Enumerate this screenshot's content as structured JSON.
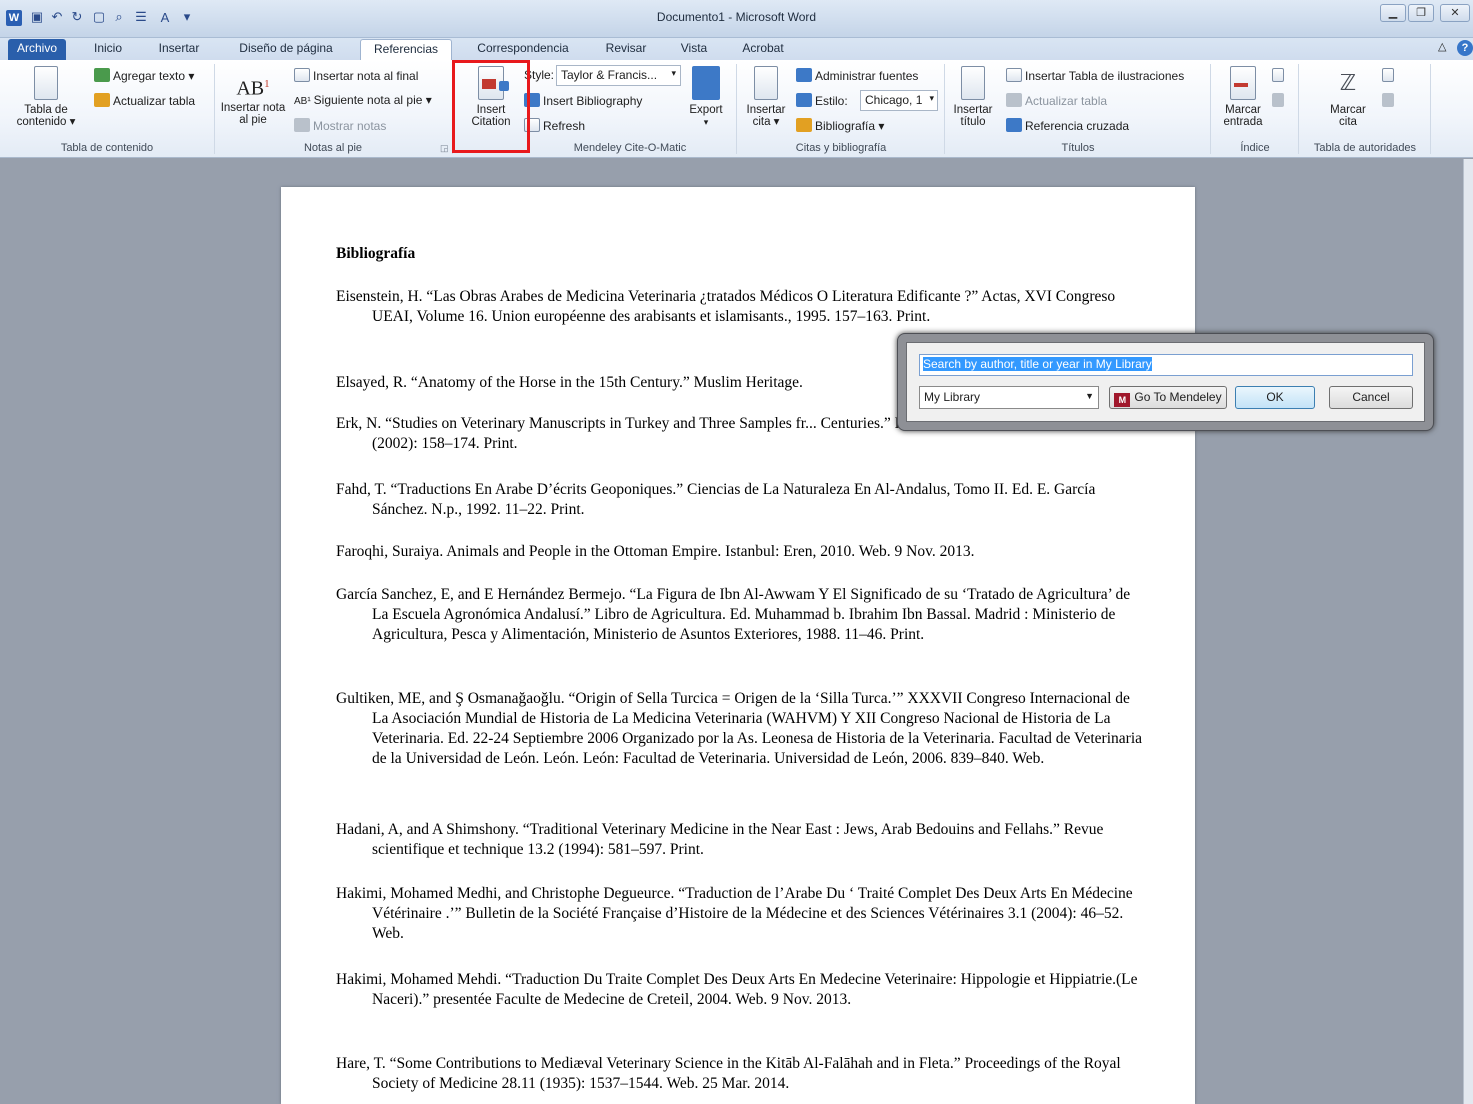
{
  "window": {
    "title": "Documento1 - Microsoft Word",
    "controls": [
      "▁",
      "❐",
      "✕"
    ]
  },
  "tabs": [
    {
      "label": "Archivo"
    },
    {
      "label": "Inicio"
    },
    {
      "label": "Insertar"
    },
    {
      "label": "Diseño de página"
    },
    {
      "label": "Referencias"
    },
    {
      "label": "Correspondencia"
    },
    {
      "label": "Revisar"
    },
    {
      "label": "Vista"
    },
    {
      "label": "Acrobat"
    }
  ],
  "active_tab": "Referencias",
  "ribbon": {
    "toc": {
      "table_btn": "Tabla de contenido ▾",
      "add_text": "Agregar texto ▾",
      "update_table": "Actualizar tabla",
      "group": "Tabla de contenido"
    },
    "footnotes": {
      "insert_footnote": "Insertar nota al pie",
      "insert_endnote": "Insertar nota al final",
      "next_footnote": "Siguiente nota al pie ▾",
      "show_notes": "Mostrar notas",
      "group": "Notas al pie"
    },
    "mendeley": {
      "insert_citation": "Insert Citation",
      "style_label": "Style:",
      "style_value": "Taylor & Francis...",
      "insert_bibliography": "Insert Bibliography",
      "refresh": "Refresh",
      "export": "Export",
      "group": "Mendeley Cite-O-Matic"
    },
    "citations": {
      "insert_cite": "Insertar cita ▾",
      "manage_sources": "Administrar fuentes",
      "style_label": "Estilo:",
      "style_value": "Chicago, 1",
      "bibliography": "Bibliografía ▾",
      "group": "Citas y bibliografía"
    },
    "captions": {
      "insert_caption": "Insertar título",
      "insert_table_figures": "Insertar Tabla de ilustraciones",
      "update_table": "Actualizar tabla",
      "cross_reference": "Referencia cruzada",
      "group": "Títulos"
    },
    "index": {
      "mark_entry": "Marcar entrada",
      "group": "Índice"
    },
    "authorities": {
      "mark_citation": "Marcar cita",
      "group": "Tabla de autoridades"
    }
  },
  "document": {
    "heading": "Bibliografía",
    "entries": [
      "Eisenstein, H. “Las Obras Arabes de Medicina Veterinaria ¿tratados Médicos O Literatura Edificante ?” Actas, XVI Congreso UEAI, Volume 16. Union européenne des arabisants et islamisants., 1995. 157–163. Print.",
      "Elsayed, R. “Anatomy of the Horse in the 15th Century.” Muslim Heritage.",
      "Erk, N. “Studies on Veterinary Manuscripts in Turkey and Three Samples fr... Centuries.” Historia medicinae veterinariae 27.1 (2002): 158–174. Print.",
      "Fahd, T. “Traductions En Arabe D’écrits Geoponiques.” Ciencias de La Naturaleza En Al-Andalus, Tomo II. Ed. E. García Sánchez. N.p., 1992. 11–22. Print.",
      "Faroqhi, Suraiya. Animals and People in the Ottoman Empire. Istanbul: Eren, 2010. Web. 9 Nov. 2013.",
      "García Sanchez, E, and E Hernández Bermejo. “La Figura de Ibn Al-Awwam Y El Significado de su ‘Tratado de Agricultura’ de La Escuela Agronómica Andalusí.” Libro de Agricultura. Ed. Muhammad b. Ibrahim Ibn Bassal. Madrid : Ministerio de Agricultura, Pesca y Alimentación, Ministerio de Asuntos Exteriores, 1988. 11–46. Print.",
      "Gultiken, ME, and Ş Osmanağaoğlu. “Origin of Sella Turcica = Origen de la ‘Silla Turca.’” XXXVII Congreso Internacional de La Asociación Mundial de Historia de La Medicina Veterinaria (WAHVM) Y XII Congreso Nacional de Historia de La Veterinaria. Ed. 22-24 Septiembre 2006 Organizado por la As. Leonesa de Historia de la Veterinaria. Facultad de Veterinaria de la Universidad de León. León. León: Facultad de Veterinaria. Universidad de León, 2006. 839–840. Web.",
      "Hadani, A, and A Shimshony. “Traditional Veterinary Medicine in the Near East : Jews, Arab Bedouins and Fellahs.” Revue scientifique et technique 13.2 (1994): 581–597. Print.",
      "Hakimi, Mohamed Medhi, and Christophe Degueurce. “Traduction de l’Arabe Du ‘ Traité Complet Des Deux Arts En Médecine Vétérinaire .’” Bulletin de la Société Française d’Histoire de la Médecine et des Sciences Vétérinaires 3.1 (2004): 46–52. Web.",
      "Hakimi, Mohamed Mehdi. “Traduction Du Traite Complet Des Deux Arts En Medecine Veterinaire: Hippologie et Hippiatrie.(Le Naceri).” presentée Faculte de Medecine de Creteil, 2004. Web. 9 Nov. 2013.",
      "Hare, T. “Some Contributions to Mediæval Veterinary Science in the Kitāb Al-Falāhah and in Fleta.” Proceedings of the Royal Society of Medicine 28.11 (1935): 1537–1544. Web. 25 Mar. 2014."
    ]
  },
  "dialog": {
    "search_placeholder": "Search by author, title or year in My Library",
    "library_value": "My Library",
    "go_to_mendeley": "Go To Mendeley",
    "ok": "OK",
    "cancel": "Cancel"
  },
  "colors": {
    "highlight_box": "#e8191c",
    "file_tab": "#2a5fab",
    "mendeley_logo": "#a0172b"
  }
}
